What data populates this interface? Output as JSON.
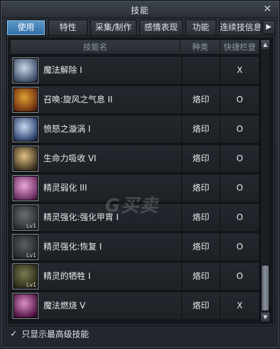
{
  "window": {
    "title": "技能",
    "close_icon": "close-icon"
  },
  "tabs": [
    {
      "label": "使用",
      "active": true
    },
    {
      "label": "特性",
      "active": false
    },
    {
      "label": "采集/制作",
      "active": false
    },
    {
      "label": "感情表现",
      "active": false
    },
    {
      "label": "功能",
      "active": false
    },
    {
      "label": "连续技信息",
      "active": false
    }
  ],
  "tab_arrow_icon": "chevron-right-icon",
  "table": {
    "headers": {
      "name": "技能名",
      "type": "种类",
      "hotkey": "快捷栏登录"
    },
    "rows": [
      {
        "name": "魔法解除 I",
        "type": "",
        "hotkey": "X",
        "icon": "magic-dispel-icon",
        "level": "",
        "colors": [
          "#c9d6e6",
          "#3a4a66"
        ]
      },
      {
        "name": "召唤:旋风之气息 II",
        "type": "烙印",
        "hotkey": "O",
        "icon": "whirlwind-summon-icon",
        "level": "",
        "colors": [
          "#e0a030",
          "#6a2a10"
        ]
      },
      {
        "name": "愤怒之漩涡 I",
        "type": "烙印",
        "hotkey": "O",
        "icon": "wrath-vortex-icon",
        "level": "",
        "colors": [
          "#c6d8f0",
          "#2a3d6a"
        ]
      },
      {
        "name": "生命力吸收 VI",
        "type": "烙印",
        "hotkey": "O",
        "icon": "life-drain-icon",
        "level": "",
        "colors": [
          "#e0c080",
          "#3a3020"
        ]
      },
      {
        "name": "精灵弱化 III",
        "type": "烙印",
        "hotkey": "O",
        "icon": "spirit-weaken-icon",
        "level": "",
        "colors": [
          "#e8a8d8",
          "#6a2a60"
        ]
      },
      {
        "name": "精灵强化:强化甲胄 I",
        "type": "烙印",
        "hotkey": "O",
        "icon": "spirit-armor-icon",
        "level": "Lv1",
        "colors": [
          "#6a6e72",
          "#2a2c2e"
        ]
      },
      {
        "name": "精灵强化:恢复 I",
        "type": "烙印",
        "hotkey": "O",
        "icon": "spirit-recovery-icon",
        "level": "Lv1",
        "colors": [
          "#5a5e62",
          "#242628"
        ]
      },
      {
        "name": "精灵的牺牲 I",
        "type": "烙印",
        "hotkey": "O",
        "icon": "spirit-sacrifice-icon",
        "level": "Lv1",
        "colors": [
          "#7a7a50",
          "#2a2a18"
        ]
      },
      {
        "name": "魔法燃烧 V",
        "type": "烙印",
        "hotkey": "X",
        "icon": "magic-burn-icon",
        "level": "",
        "colors": [
          "#e090c8",
          "#4a1040"
        ]
      }
    ]
  },
  "scrollbar": {
    "up_icon": "triangle-up-icon",
    "down_icon": "triangle-down-icon",
    "position": 0.85
  },
  "watermark": "G买卖",
  "footer": {
    "checkbox_checked": true,
    "checkbox_icon": "checkmark-icon",
    "label": "只显示最高级技能"
  }
}
